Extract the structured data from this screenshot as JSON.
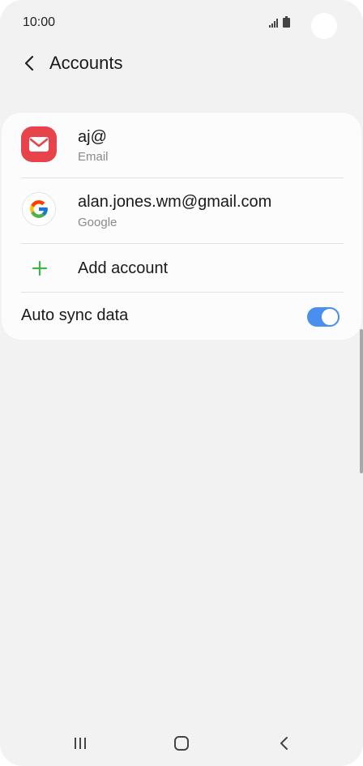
{
  "status_bar": {
    "time": "10:00"
  },
  "header": {
    "title": "Accounts",
    "back_icon": "back-arrow-icon"
  },
  "accounts": [
    {
      "title": "aj@",
      "subtitle": "Email",
      "icon": "email-app-icon",
      "icon_color": "#e8434a"
    },
    {
      "title": "alan.jones.wm@gmail.com",
      "subtitle": "Google",
      "icon": "google-icon"
    }
  ],
  "add_account": {
    "label": "Add account",
    "icon": "plus-icon",
    "icon_color": "#3db54a"
  },
  "auto_sync": {
    "label": "Auto sync data",
    "enabled": true,
    "toggle_color": "#4a8ef0"
  },
  "nav_bar": {
    "recents_icon": "recents-icon",
    "home_icon": "home-icon",
    "back_icon": "nav-back-icon"
  }
}
